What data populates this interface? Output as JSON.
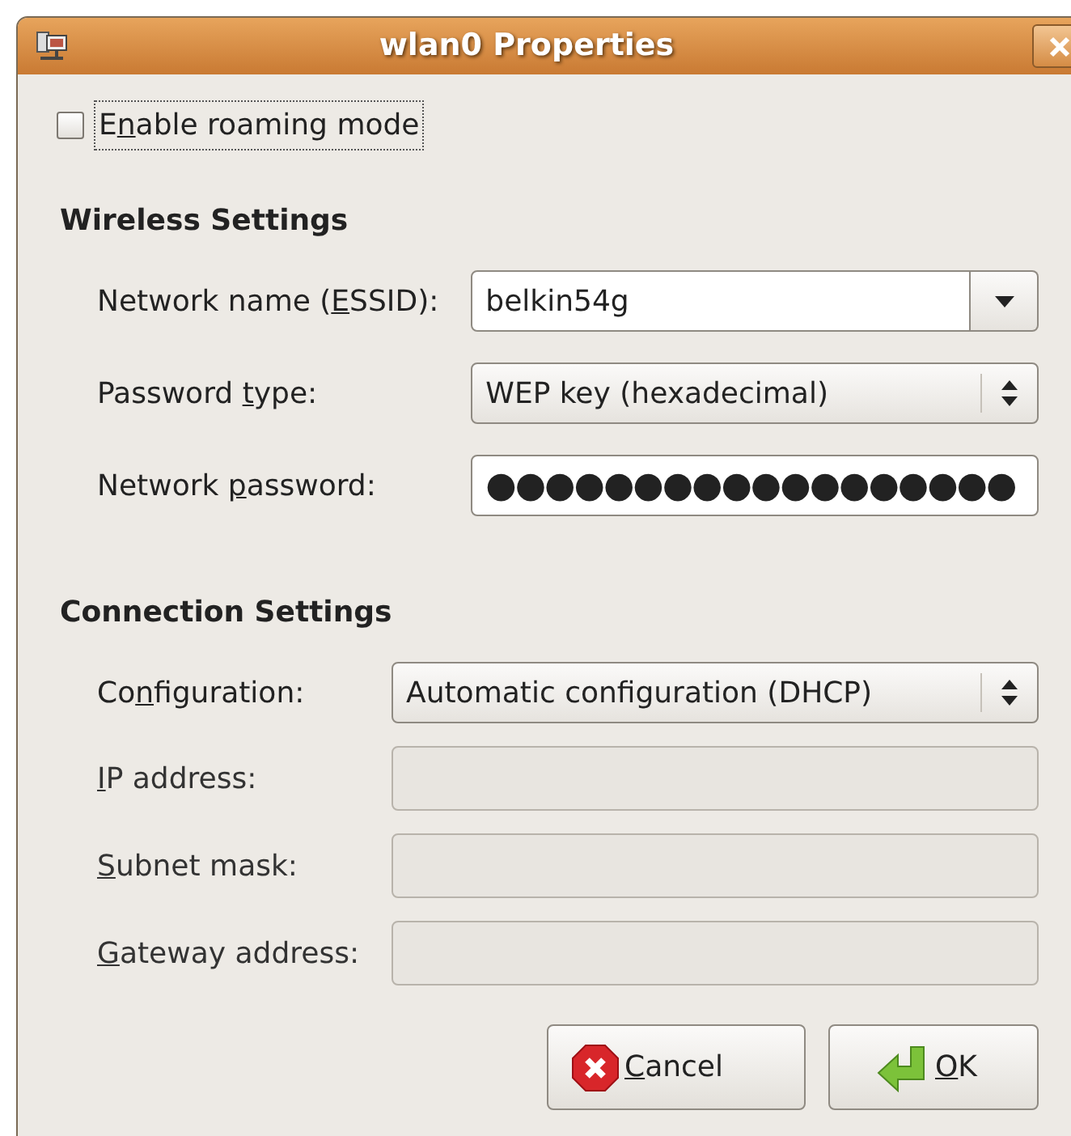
{
  "window": {
    "title": "wlan0 Properties"
  },
  "roaming": {
    "label": {
      "pre": "E",
      "key": "n",
      "post": "able roaming mode"
    },
    "checked": false,
    "focused": true
  },
  "sections": [
    {
      "title": "Wireless Settings",
      "fields": [
        {
          "kind": "combo-entry",
          "label": {
            "pre": "Network name (",
            "key": "E",
            "post": "SSID):"
          },
          "value": "belkin54g",
          "disabled": false
        },
        {
          "kind": "select",
          "label": {
            "pre": "Password ",
            "key": "t",
            "post": "ype:"
          },
          "value": "WEP key (hexadecimal)",
          "disabled": false
        },
        {
          "kind": "password",
          "label": {
            "pre": "Network ",
            "key": "p",
            "post": "assword:"
          },
          "value": "●●●●●●●●●●●●●●●●●●",
          "disabled": false
        }
      ]
    },
    {
      "title": "Connection Settings",
      "fields": [
        {
          "kind": "select",
          "label": {
            "pre": "Co",
            "key": "n",
            "post": "figuration:"
          },
          "value": "Automatic configuration (DHCP)",
          "disabled": false
        },
        {
          "kind": "entry",
          "label": {
            "key": "I",
            "post": "P address:"
          },
          "disabled": true
        },
        {
          "kind": "entry",
          "label": {
            "key": "S",
            "post": "ubnet mask:"
          },
          "disabled": true
        },
        {
          "kind": "entry",
          "label": {
            "key": "G",
            "post": "ateway address:"
          },
          "disabled": true
        }
      ]
    }
  ],
  "buttons": [
    {
      "kind": "cancel",
      "label": {
        "key": "C",
        "post": "ancel"
      }
    },
    {
      "kind": "ok",
      "label": {
        "key": "O",
        "post": "K"
      }
    }
  ]
}
